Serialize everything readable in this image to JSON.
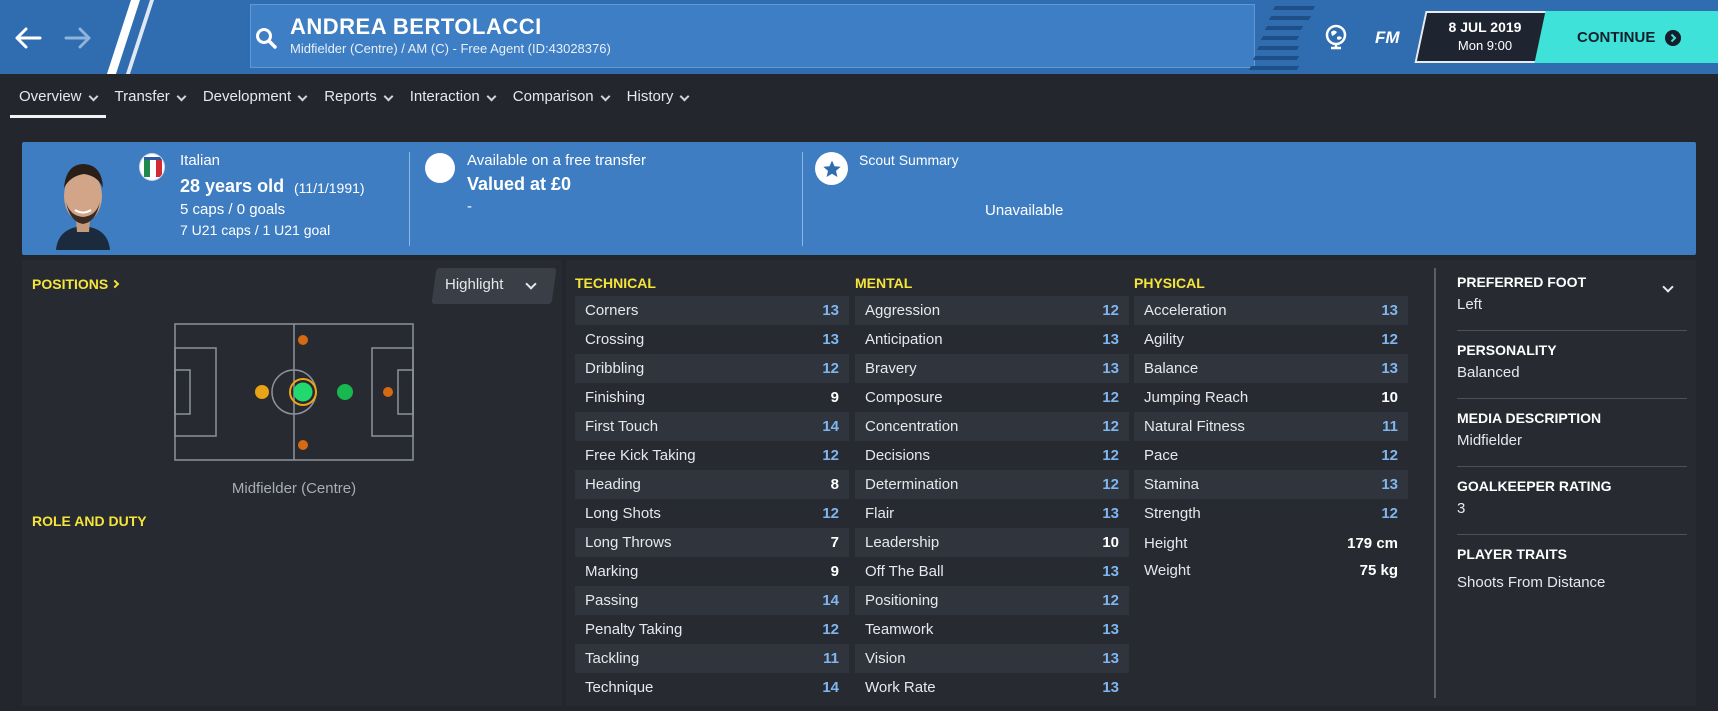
{
  "header": {
    "player_name": "ANDREA BERTOLACCI",
    "player_subtitle": "Midfielder (Centre) / AM (C) - Free Agent (ID:43028376)",
    "logo": "FM",
    "date": "8 JUL 2019",
    "day_time": "Mon 9:00",
    "continue_label": "CONTINUE",
    "icons": [
      "back-arrow-icon",
      "forward-arrow-icon",
      "search-icon",
      "globe-icon",
      "continue-arrow-icon"
    ]
  },
  "tabs": [
    {
      "label": "Overview",
      "active": true
    },
    {
      "label": "Transfer"
    },
    {
      "label": "Development"
    },
    {
      "label": "Reports"
    },
    {
      "label": "Interaction"
    },
    {
      "label": "Comparison"
    },
    {
      "label": "History"
    }
  ],
  "banner": {
    "nationality": "Italian",
    "age": "28 years old",
    "dob": "(11/1/1991)",
    "caps": "5 caps / 0 goals",
    "u21_caps": "7 U21 caps / 1 U21 goal",
    "transfer_status": "Available on a free transfer",
    "value": "Valued at £0",
    "value_sub": "-",
    "scout_title": "Scout Summary",
    "scout_value": "Unavailable"
  },
  "positions": {
    "title": "POSITIONS",
    "highlight_label": "Highlight",
    "position_label": "Midfielder (Centre)",
    "role_title": "ROLE AND DUTY"
  },
  "technical": {
    "title": "TECHNICAL",
    "attributes": [
      {
        "name": "Corners",
        "value": "13"
      },
      {
        "name": "Crossing",
        "value": "13"
      },
      {
        "name": "Dribbling",
        "value": "12"
      },
      {
        "name": "Finishing",
        "value": "9"
      },
      {
        "name": "First Touch",
        "value": "14"
      },
      {
        "name": "Free Kick Taking",
        "value": "12"
      },
      {
        "name": "Heading",
        "value": "8"
      },
      {
        "name": "Long Shots",
        "value": "12"
      },
      {
        "name": "Long Throws",
        "value": "7"
      },
      {
        "name": "Marking",
        "value": "9"
      },
      {
        "name": "Passing",
        "value": "14"
      },
      {
        "name": "Penalty Taking",
        "value": "12"
      },
      {
        "name": "Tackling",
        "value": "11"
      },
      {
        "name": "Technique",
        "value": "14"
      }
    ]
  },
  "mental": {
    "title": "MENTAL",
    "attributes": [
      {
        "name": "Aggression",
        "value": "12"
      },
      {
        "name": "Anticipation",
        "value": "13"
      },
      {
        "name": "Bravery",
        "value": "13"
      },
      {
        "name": "Composure",
        "value": "12"
      },
      {
        "name": "Concentration",
        "value": "12"
      },
      {
        "name": "Decisions",
        "value": "12"
      },
      {
        "name": "Determination",
        "value": "12"
      },
      {
        "name": "Flair",
        "value": "13"
      },
      {
        "name": "Leadership",
        "value": "10"
      },
      {
        "name": "Off The Ball",
        "value": "13"
      },
      {
        "name": "Positioning",
        "value": "12"
      },
      {
        "name": "Teamwork",
        "value": "13"
      },
      {
        "name": "Vision",
        "value": "13"
      },
      {
        "name": "Work Rate",
        "value": "13"
      }
    ]
  },
  "physical": {
    "title": "PHYSICAL",
    "attributes": [
      {
        "name": "Acceleration",
        "value": "13"
      },
      {
        "name": "Agility",
        "value": "12"
      },
      {
        "name": "Balance",
        "value": "13"
      },
      {
        "name": "Jumping Reach",
        "value": "10"
      },
      {
        "name": "Natural Fitness",
        "value": "11"
      },
      {
        "name": "Pace",
        "value": "12"
      },
      {
        "name": "Stamina",
        "value": "13"
      },
      {
        "name": "Strength",
        "value": "12"
      }
    ],
    "height_label": "Height",
    "height_value": "179 cm",
    "weight_label": "Weight",
    "weight_value": "75 kg"
  },
  "info": [
    {
      "title": "PREFERRED FOOT",
      "value": "Left"
    },
    {
      "title": "PERSONALITY",
      "value": "Balanced"
    },
    {
      "title": "MEDIA DESCRIPTION",
      "value": "Midfielder"
    },
    {
      "title": "GOALKEEPER RATING",
      "value": "3"
    },
    {
      "title": "PLAYER TRAITS",
      "value": "Shoots From Distance"
    }
  ],
  "colors": {
    "header_blue": "#2f6db0",
    "banner_blue": "#3e7dc2",
    "accent_yellow": "#f5e43a",
    "continue_cyan": "#3ee2d9",
    "stat_blue": "#7fb6ef",
    "background": "#23262d"
  }
}
